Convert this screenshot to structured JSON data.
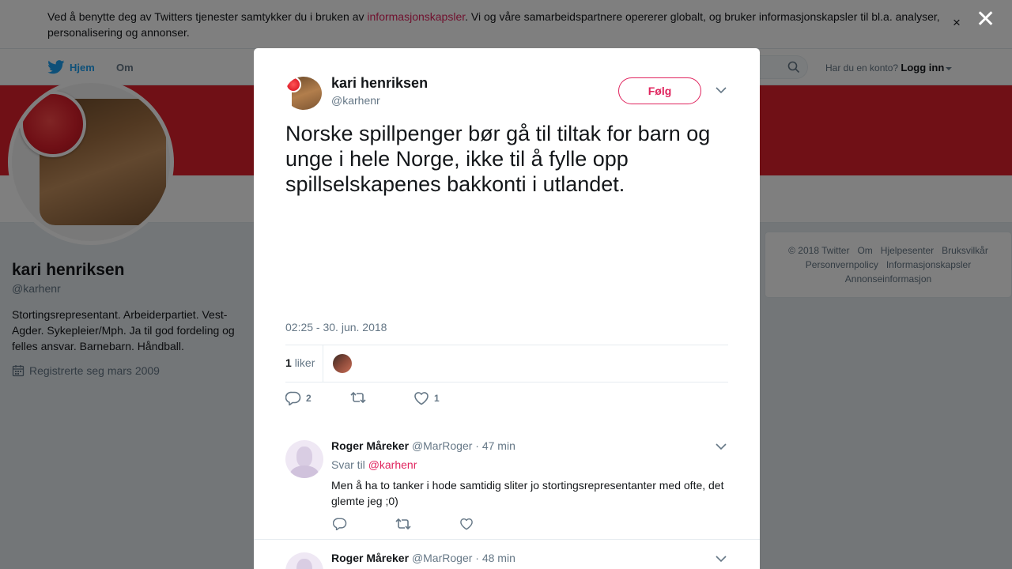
{
  "cookie_bar": {
    "text_before": "Ved å benytte deg av Twitters tjenester samtykker du i bruken av ",
    "link": "informasjonskapsler",
    "text_after": ". Vi og våre samarbeidspartnere opererer globalt, og bruker informasjonskapsler til bl.a. analyser, personalisering og annonser.",
    "close": "×"
  },
  "navbar": {
    "home": "Hjem",
    "about": "Om",
    "have_account": "Har du en konto?",
    "login": "Logg inn"
  },
  "profile": {
    "name": "kari henriksen",
    "handle": "@karhenr",
    "bio": "Stortingsrepresentant. Arbeiderpartiet. Vest-Agder. Sykepleier/Mph. Ja til god fordeling og felles ansvar. Barnebarn. Håndball.",
    "joined": "Registrerte seg mars 2009"
  },
  "footer": {
    "links": [
      "© 2018 Twitter",
      "Om",
      "Hjelpesenter",
      "Bruksvilkår",
      "Personvernpolicy",
      "Informasjonskapsler",
      "Annonseinformasjon"
    ]
  },
  "overlay_close": "✕",
  "tweet": {
    "author_name": "kari henriksen",
    "author_handle": "@karhenr",
    "follow_label": "Følg",
    "text": "Norske spillpenger bør gå til tiltak for barn og unge i hele Norge, ikke til å fylle opp spillselskapenes bakkonti i utlandet.",
    "timestamp": "02:25 - 30. jun. 2018",
    "likes_count": "1",
    "likes_label": "liker",
    "reply_count": "2",
    "like_count": "1"
  },
  "replies": [
    {
      "name": "Roger Måreker",
      "handle": "@MarRoger",
      "time": "· 47 min",
      "reply_to_label": "Svar til",
      "reply_to": "@karhenr",
      "text": "Men å ha to tanker i hode samtidig sliter jo stortingsrepresentanter med ofte, det glemte jeg ;0)"
    },
    {
      "name": "Roger Måreker",
      "handle": "@MarRoger",
      "time": "· 48 min"
    }
  ],
  "colors": {
    "accent": "#e0245e",
    "banner": "#e0202c",
    "link_blue": "#1da1f2",
    "muted": "#657786"
  }
}
